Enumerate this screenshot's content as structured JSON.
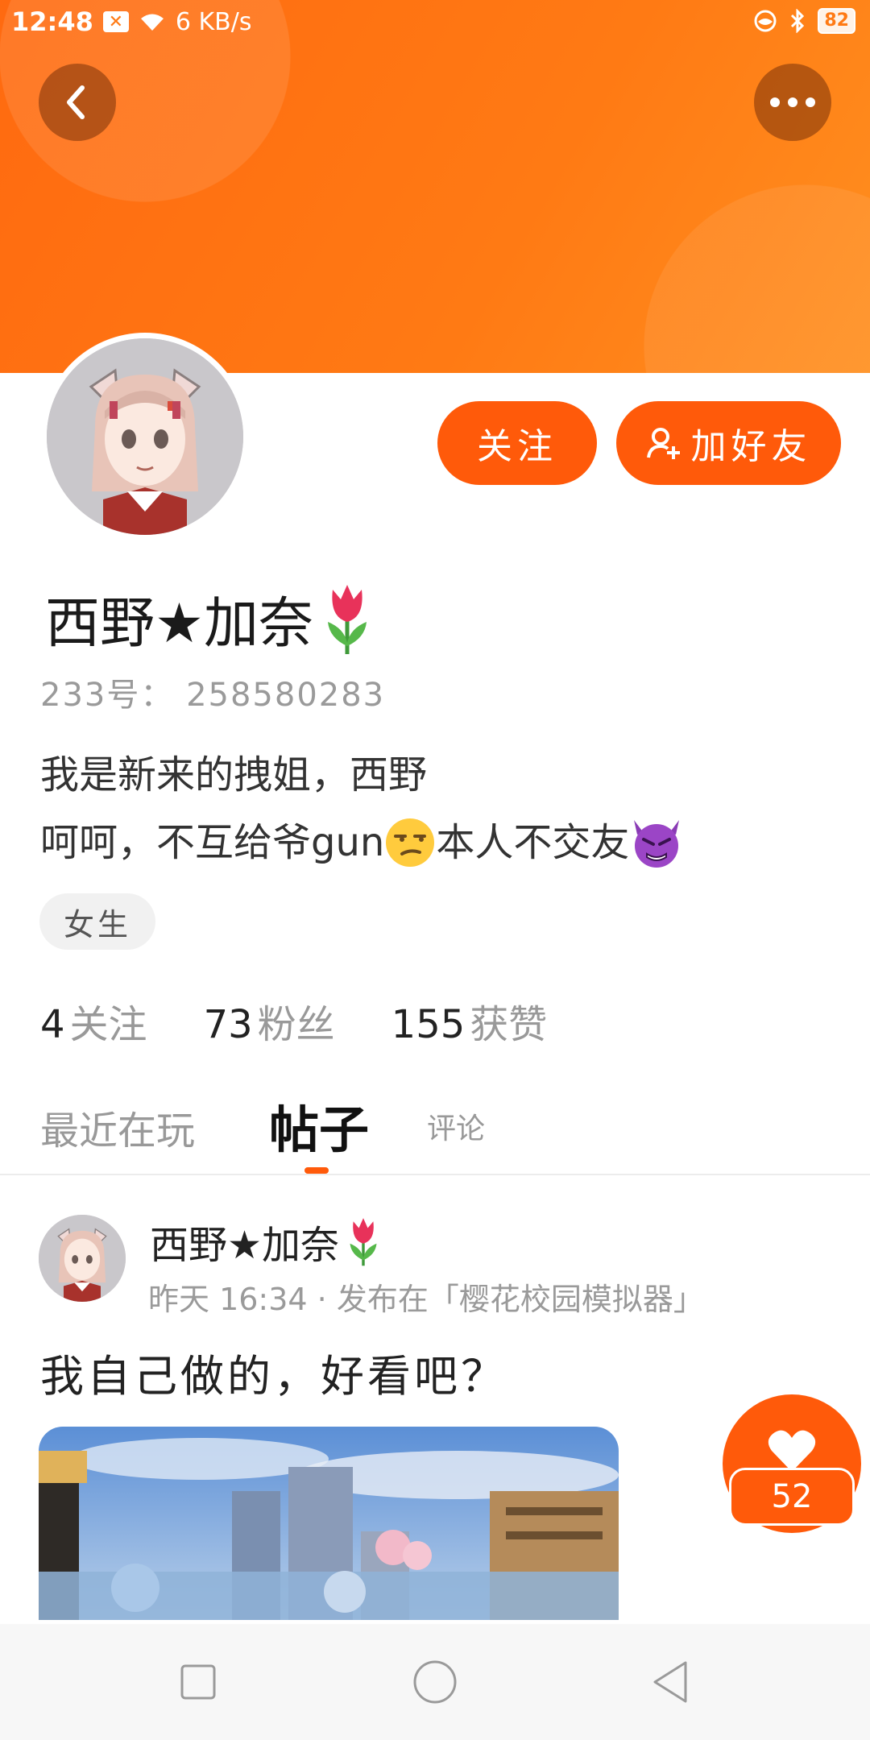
{
  "status_bar": {
    "time": "12:48",
    "network_speed": "6 KB/s",
    "battery": "82"
  },
  "profile": {
    "name": "西野★加奈",
    "id_label": "233号：",
    "id_value": "258580283",
    "bio_line1": "我是新来的拽姐，西野",
    "bio_line2_a": "呵呵，不互给爷gun",
    "bio_line2_b": "本人不交友",
    "gender_tag": "女生",
    "follow_button": "关注",
    "add_friend_button": "加好友"
  },
  "stats": [
    {
      "num": "4",
      "label": "关注"
    },
    {
      "num": "73",
      "label": "粉丝"
    },
    {
      "num": "155",
      "label": "获赞"
    }
  ],
  "tabs": {
    "recent": "最近在玩",
    "posts": "帖子",
    "comments": "评论"
  },
  "post": {
    "author": "西野★加奈",
    "meta": "昨天 16:34 · 发布在「樱花校园模拟器」",
    "text": "我自己做的，好看吧？",
    "likes": "52"
  },
  "icons": {
    "back": "back-arrow-icon",
    "more": "more-dots-icon",
    "add_friend": "add-user-icon",
    "like": "heart-icon",
    "tulip": "tulip-icon"
  },
  "colors": {
    "accent": "#ff5a0a",
    "banner": "#ff7a14"
  }
}
